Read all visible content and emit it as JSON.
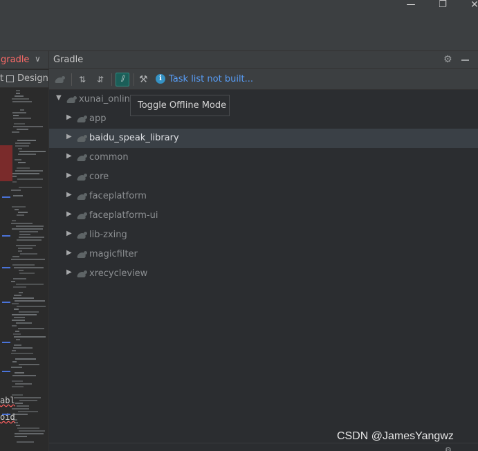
{
  "window": {
    "minimize_glyph": "—",
    "maximize_glyph": "❐",
    "close_glyph": "✕"
  },
  "editor": {
    "tab_label": "gradle",
    "tab_chevron": "∨",
    "mode_text_label": "t",
    "mode_design_label": "Design",
    "code_fragment_1": "abl",
    "code_fragment_2": "oid"
  },
  "gradle": {
    "panel_title": "Gradle",
    "gear_glyph": "⚙",
    "task_status_link": "Task list not built...",
    "info_glyph": "i",
    "tooltip": "Toggle Offline Mode",
    "offline_glyph": "⫽",
    "expand_glyph": "⇅",
    "collapse_glyph": "⇵",
    "wrench_glyph": "🔧",
    "tree": {
      "root": "xunai_online",
      "modules": [
        "app",
        "baidu_speak_library",
        "common",
        "core",
        "faceplatform",
        "faceplatform-ui",
        "lib-zxing",
        "magicfilter",
        "xrecycleview"
      ],
      "selected_module": "baidu_speak_library",
      "expanded_arrow": "▼",
      "collapsed_arrow": "▶"
    }
  },
  "watermark": "CSDN @JamesYangwz",
  "colors": {
    "accent_link": "#589df6",
    "offline_active": "#1b5e58",
    "error_tab": "#ff6b68"
  }
}
